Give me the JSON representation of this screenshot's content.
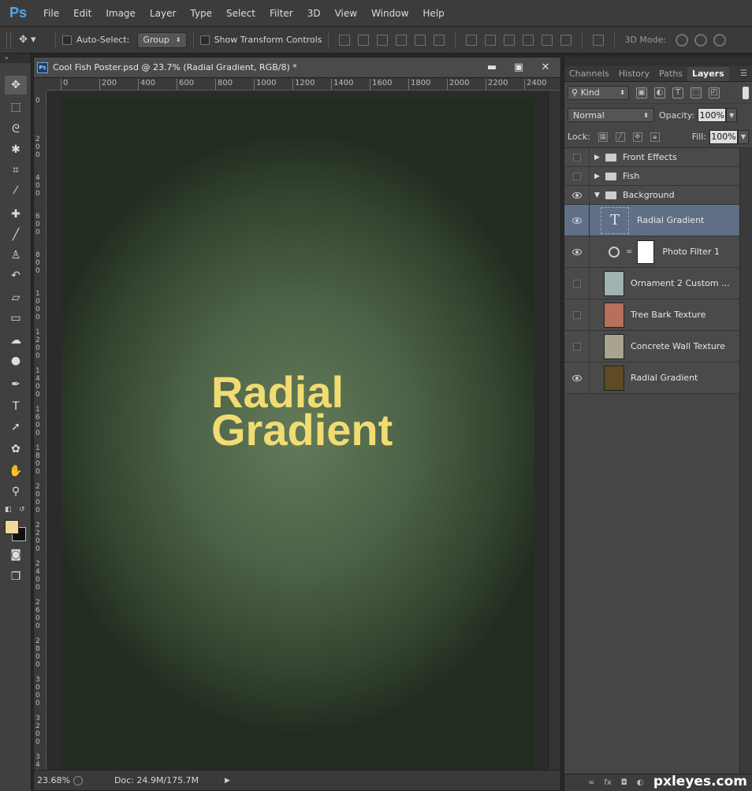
{
  "app": {
    "logo": "Ps"
  },
  "menu": [
    "File",
    "Edit",
    "Image",
    "Layer",
    "Type",
    "Select",
    "Filter",
    "3D",
    "View",
    "Window",
    "Help"
  ],
  "options": {
    "auto_select_label": "Auto-Select:",
    "auto_select_value": "Group",
    "show_transform_label": "Show Transform Controls",
    "mode_3d_label": "3D Mode:"
  },
  "document": {
    "title": "Cool Fish Poster.psd @ 23.7% (Radial  Gradient, RGB/8) *",
    "ruler_top": [
      "0",
      "200",
      "400",
      "600",
      "800",
      "1000",
      "1200",
      "1400",
      "1600",
      "1800",
      "2000",
      "2200",
      "2400"
    ],
    "ruler_left": [
      "0",
      "200",
      "400",
      "600",
      "800",
      "1000",
      "1200",
      "1400",
      "1600",
      "1800",
      "2000",
      "2200",
      "2400",
      "2600",
      "2800",
      "3000",
      "3200",
      "3400"
    ],
    "canvas_text_line1": "Radial",
    "canvas_text_line2": "Gradient",
    "canvas_text_color": "#f1dc72",
    "zoom": "23.68%",
    "doc_info": "Doc: 24.9M/175.7M"
  },
  "panel": {
    "tabs": [
      "Channels",
      "History",
      "Paths",
      "Layers"
    ],
    "active_tab": "Layers",
    "kind": "Kind",
    "blend_mode": "Normal",
    "opacity_label": "Opacity:",
    "opacity_value": "100%",
    "lock_label": "Lock:",
    "fill_label": "Fill:",
    "fill_value": "100%"
  },
  "layers": [
    {
      "name": "Front Effects",
      "type": "group",
      "visible": false,
      "expanded": false
    },
    {
      "name": "Fish",
      "type": "group",
      "visible": false,
      "expanded": false
    },
    {
      "name": "Background",
      "type": "group",
      "visible": true,
      "expanded": true
    },
    {
      "name": "Radial  Gradient",
      "type": "text",
      "visible": true,
      "selected": true
    },
    {
      "name": "Photo Filter 1",
      "type": "adjustment",
      "visible": true
    },
    {
      "name": "Ornament 2 Custom ...",
      "type": "image",
      "visible": false,
      "thumb": "#9fb3b0"
    },
    {
      "name": "Tree Bark Texture",
      "type": "image",
      "visible": false,
      "thumb": "#b7715a"
    },
    {
      "name": "Concrete Wall Texture",
      "type": "image",
      "visible": false,
      "thumb": "#a9a390"
    },
    {
      "name": "Radial Gradient",
      "type": "image",
      "visible": true,
      "thumb": "#5e4a24"
    }
  ],
  "watermark": "pxleyes.com"
}
